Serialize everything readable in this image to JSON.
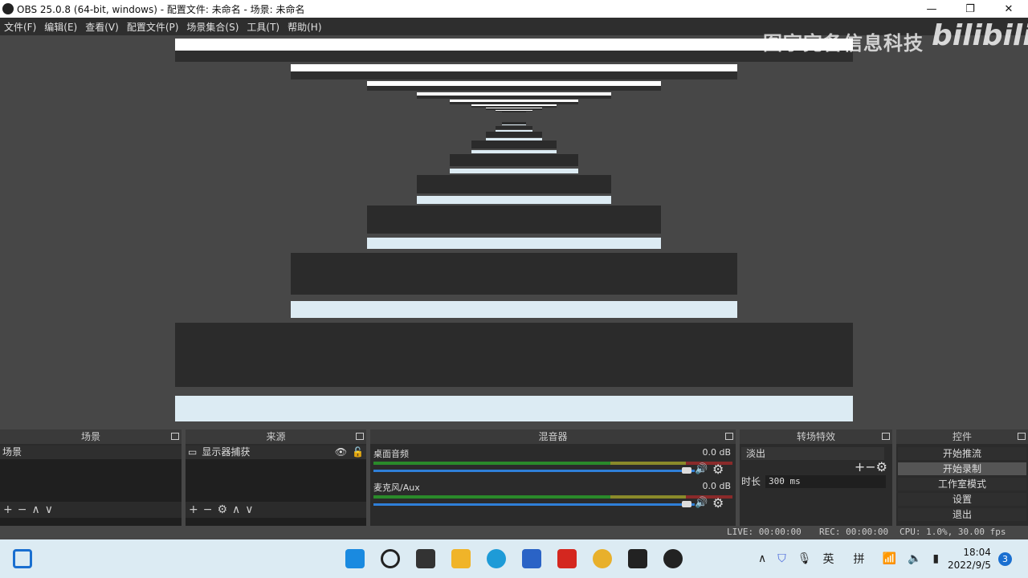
{
  "window": {
    "title": "OBS 25.0.8 (64-bit, windows) - 配置文件: 未命名 - 场景: 未命名",
    "minimize": "—",
    "maximize": "❐",
    "close": "✕"
  },
  "menu": [
    "文件(F)",
    "编辑(E)",
    "查看(V)",
    "配置文件(P)",
    "场景集合(S)",
    "工具(T)",
    "帮助(H)"
  ],
  "watermark": {
    "text": "图宇完备信息科技",
    "brand": "bilibili"
  },
  "docks": {
    "scenes": {
      "title": "场景",
      "items": [
        "场景"
      ]
    },
    "sources": {
      "title": "来源",
      "items": [
        "显示器捕获"
      ]
    },
    "mixer": {
      "title": "混音器",
      "channels": [
        {
          "name": "桌面音频",
          "db": "0.0 dB"
        },
        {
          "name": "麦克风/Aux",
          "db": "0.0 dB"
        }
      ]
    },
    "transitions": {
      "title": "转场特效",
      "selected": "淡出",
      "duration_label": "时长",
      "duration": "300 ms"
    },
    "controls": {
      "title": "控件",
      "buttons": [
        "开始推流",
        "开始录制",
        "工作室模式",
        "设置",
        "退出"
      ]
    }
  },
  "status": {
    "live": "LIVE: 00:00:00",
    "rec": "REC: 00:00:00",
    "cpu": "CPU: 1.0%, 30.00 fps"
  },
  "taskbar": {
    "lang1": "英",
    "lang2": "拼",
    "time": "18:04",
    "date": "2022/9/5",
    "notifications": "3"
  },
  "colors": {
    "accent": "#2f7fd8",
    "taskbar": "#dcebf3",
    "meter_green": "#2a8a2a",
    "meter_yellow": "#8a8a2a",
    "meter_red": "#8a2a2a"
  }
}
